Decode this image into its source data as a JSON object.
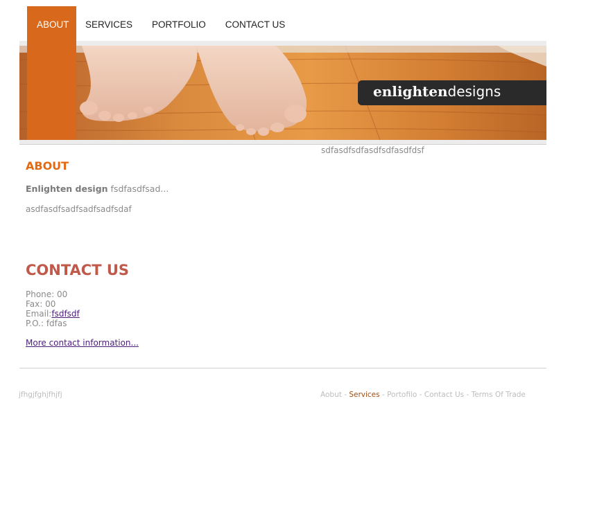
{
  "nav": {
    "items": [
      {
        "label": "ABOUT",
        "active": true
      },
      {
        "label": "SERVICES"
      },
      {
        "label": "PORTFOLIO"
      },
      {
        "label": "CONTACT US"
      }
    ]
  },
  "header": {
    "logo_bold": "enlighten",
    "logo_light": "designs",
    "side_text": "sdfasdfsdfasdfsdfasdfdsf"
  },
  "about": {
    "title": "ABOUT",
    "bold_text": "Enlighten design",
    "line1_rest": " fsdfasdfsad...",
    "line2": "asdfasdfsadfsadfsadfsdaf"
  },
  "contact": {
    "title": "CONTACT US",
    "phone_label": "Phone: 00",
    "fax_label": "Fax: 00",
    "email_prefix": "Email:",
    "email_link": "fsdfsdf",
    "po_label": "P.O.: fdfas",
    "more_link": "More contact information..."
  },
  "footer": {
    "left_text": "jfhgjfghjfhjfj",
    "links": [
      "Aobut",
      "Services",
      "Portofilo",
      "Contact Us",
      "Terms Of Trade"
    ],
    "separator": " - ",
    "active_link_color": "#a24e10"
  },
  "colors": {
    "accent": "#d8691c",
    "about_title": "#e46a12",
    "contact_title": "#c0594a"
  }
}
